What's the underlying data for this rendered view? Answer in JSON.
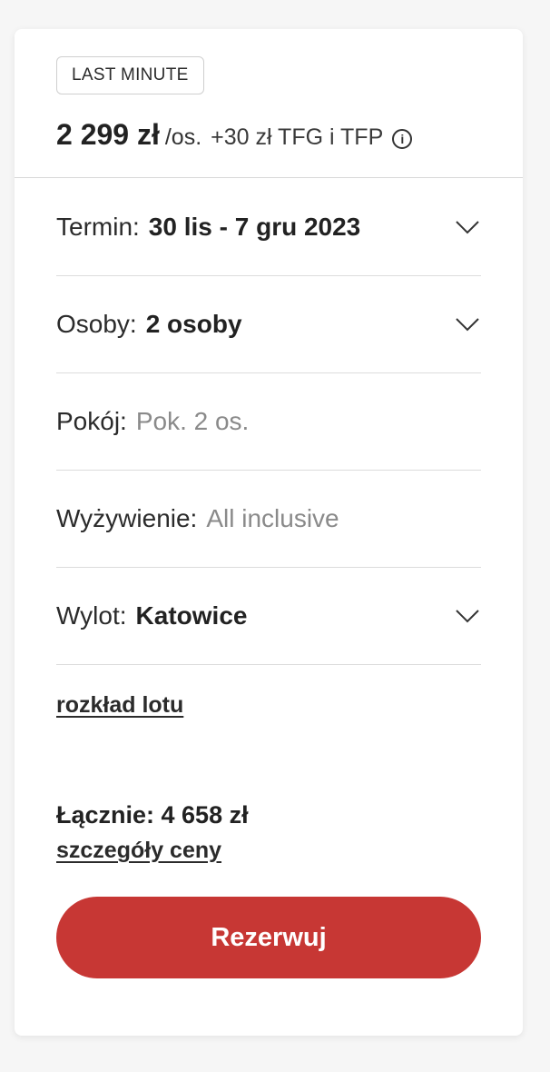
{
  "offer": {
    "badge": "LAST MINUTE",
    "price": "2 299 zł",
    "per_person": "/os.",
    "extra_fee": "+30 zł TFG i TFP",
    "info_icon": "info-icon"
  },
  "fields": {
    "term": {
      "label": "Termin:",
      "value": "30 lis - 7 gru 2023"
    },
    "people": {
      "label": "Osoby:",
      "value": "2 osoby"
    },
    "room": {
      "label": "Pokój:",
      "value": "Pok. 2 os."
    },
    "board": {
      "label": "Wyżywienie:",
      "value": "All inclusive"
    },
    "departure": {
      "label": "Wylot:",
      "value": "Katowice"
    }
  },
  "flight_schedule_link": "rozkład lotu",
  "total": {
    "text": "Łącznie: 4 658 zł"
  },
  "price_details_link": "szczegóły ceny",
  "book_button": "Rezerwuj",
  "colors": {
    "accent": "#c73734",
    "muted_text": "#8a8a8a",
    "divider": "#dcdcdc"
  }
}
